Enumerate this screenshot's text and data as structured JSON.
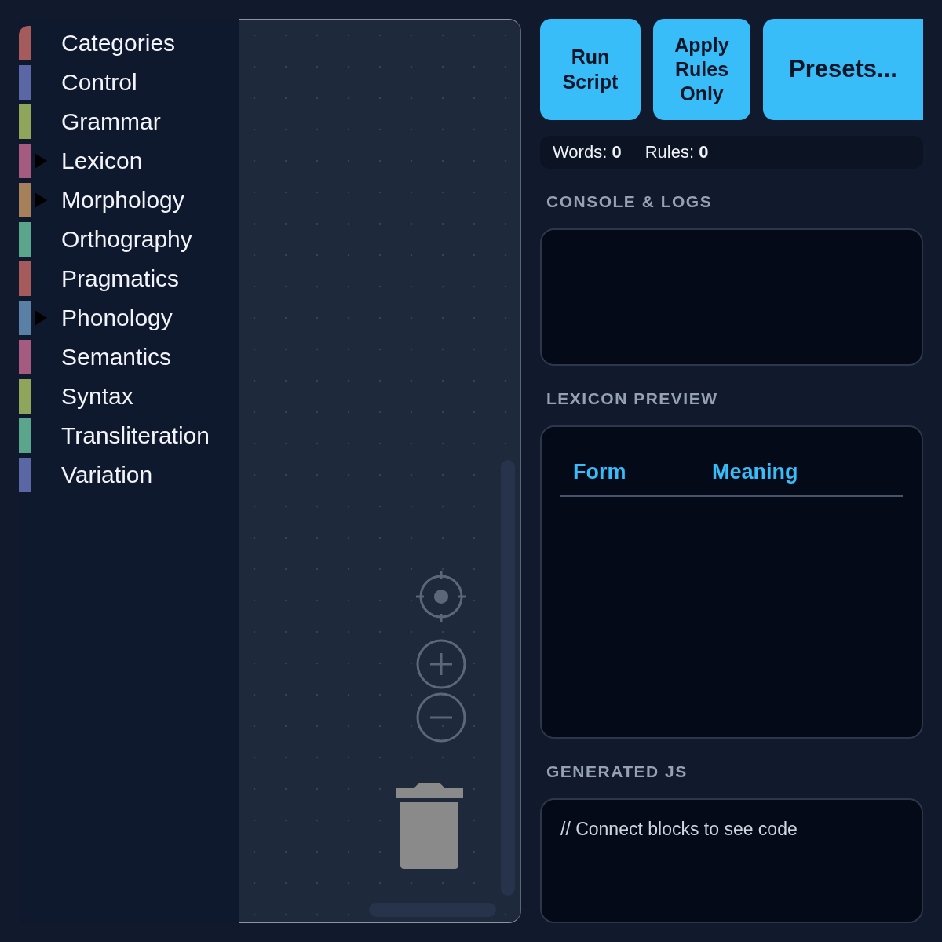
{
  "toolbox": {
    "categories": [
      {
        "label": "Categories",
        "color": "#a55b5b",
        "collapsible": false
      },
      {
        "label": "Control",
        "color": "#5b67a5",
        "collapsible": false
      },
      {
        "label": "Grammar",
        "color": "#8fa55b",
        "collapsible": false
      },
      {
        "label": "Lexicon",
        "color": "#a55b80",
        "collapsible": true
      },
      {
        "label": "Morphology",
        "color": "#a5805b",
        "collapsible": true
      },
      {
        "label": "Orthography",
        "color": "#5ba58c",
        "collapsible": false
      },
      {
        "label": "Pragmatics",
        "color": "#a55b5b",
        "collapsible": false
      },
      {
        "label": "Phonology",
        "color": "#5b80a5",
        "collapsible": true
      },
      {
        "label": "Semantics",
        "color": "#a55b80",
        "collapsible": false
      },
      {
        "label": "Syntax",
        "color": "#8fa55b",
        "collapsible": false
      },
      {
        "label": "Transliteration",
        "color": "#5ba58c",
        "collapsible": false
      },
      {
        "label": "Variation",
        "color": "#5b67a5",
        "collapsible": false
      }
    ]
  },
  "actions": [
    {
      "label": "Run Script",
      "kind": "small"
    },
    {
      "label": "Apply Rules Only",
      "kind": "small"
    },
    {
      "label": "Presets...",
      "kind": "wide"
    }
  ],
  "stats": [
    "Words: **0**",
    "Rules: **0**"
  ],
  "console": {
    "title": "CONSOLE & LOGS"
  },
  "lexicon_preview": {
    "title": "LEXICON PREVIEW",
    "columns": [
      "Form",
      "Meaning"
    ]
  },
  "generated_js": {
    "title": "GENERATED JS",
    "code": "// Connect blocks to see code"
  }
}
